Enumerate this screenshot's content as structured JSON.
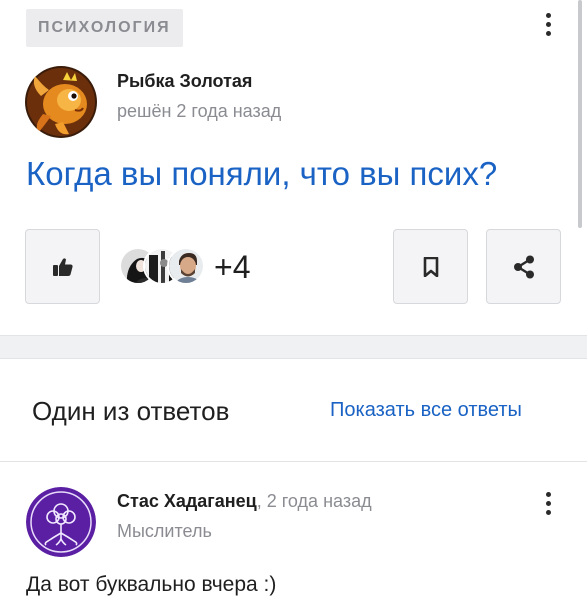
{
  "question": {
    "category": "психология",
    "author_name": "Рыбка Золотая",
    "author_meta": "решён 2 года назад",
    "title": "Когда вы поняли, что вы псих?",
    "likers_more": "+4"
  },
  "answers": {
    "heading": "Один из ответов",
    "show_all": "Показать все ответы",
    "first": {
      "author_name": "Стас Хадаганец",
      "time": ", 2 года назад",
      "rank": "Мыслитель",
      "text": "Да вот буквально вчера :)"
    }
  },
  "icons": {
    "menu": "kebab-icon",
    "like": "thumbs-up-icon",
    "bookmark": "bookmark-icon",
    "share": "share-icon"
  },
  "colors": {
    "link": "#1a63c4",
    "muted": "#8a8c92",
    "background": "#f0f1f3"
  }
}
